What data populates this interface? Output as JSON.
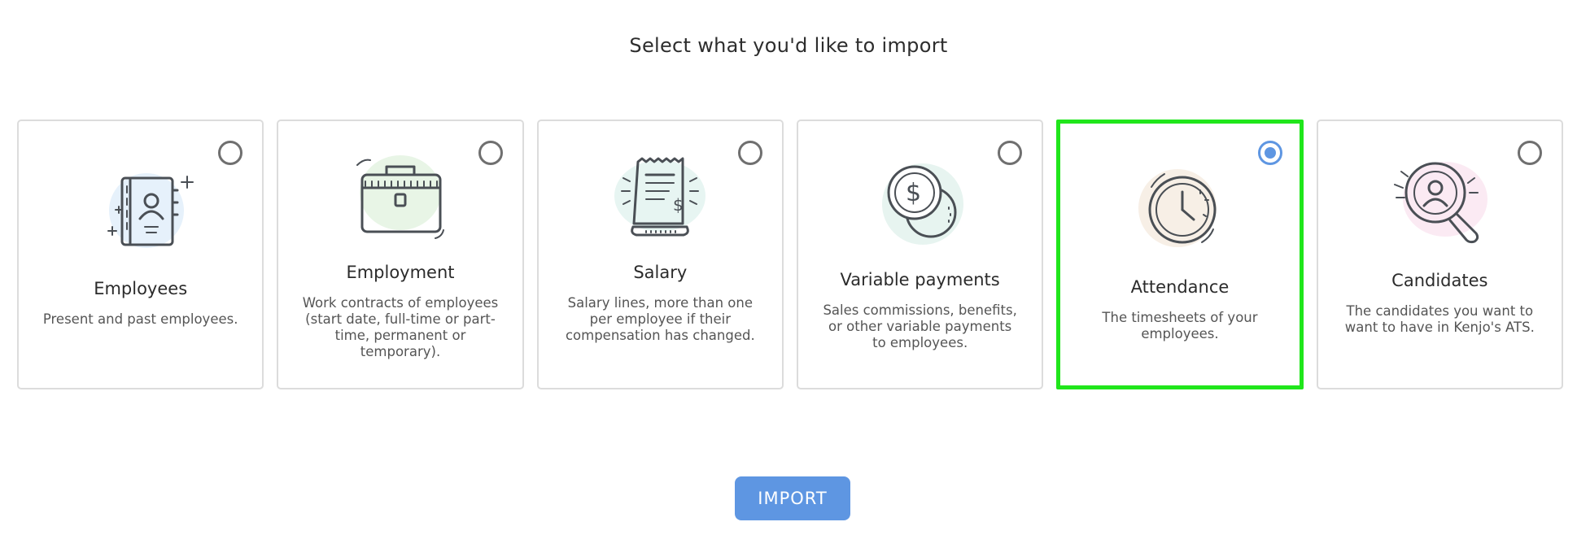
{
  "header": {
    "title": "Select what you'd like to import"
  },
  "options": [
    {
      "title": "Employees",
      "description": "Present and past employees.",
      "icon": "address-book-icon",
      "selected": false
    },
    {
      "title": "Employment",
      "description": "Work contracts of employees (start date, full-time or part-time, permanent or temporary).",
      "icon": "briefcase-icon",
      "selected": false
    },
    {
      "title": "Salary",
      "description": "Salary lines, more than one per employee if their compensation has changed.",
      "icon": "receipt-icon",
      "selected": false
    },
    {
      "title": "Variable payments",
      "description": "Sales commissions, benefits, or other variable payments to employees.",
      "icon": "coins-icon",
      "selected": false
    },
    {
      "title": "Attendance",
      "description": "The timesheets of your employees.",
      "icon": "clock-icon",
      "selected": true
    },
    {
      "title": "Candidates",
      "description": "The candidates you want to want to have in Kenjo's ATS.",
      "icon": "magnifier-user-icon",
      "selected": false
    }
  ],
  "actions": {
    "import_label": "IMPORT"
  },
  "colors": {
    "accent": "#5e96e2",
    "selected_border": "#20e61b",
    "card_border": "#dcdcdc"
  }
}
